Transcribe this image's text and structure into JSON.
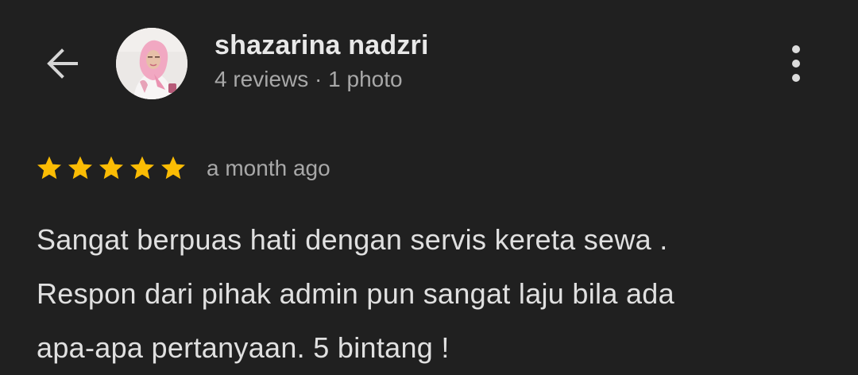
{
  "reviewer": {
    "name": "shazarina nadzri",
    "meta": "4 reviews · 1 photo"
  },
  "review": {
    "rating": 5,
    "rating_max": 5,
    "time": "a month ago",
    "lines": [
      "Sangat berpuas hati dengan servis kereta sewa .",
      "Respon dari pihak admin pun sangat laju bila ada",
      "apa-apa pertanyaan. 5 bintang !"
    ]
  },
  "icons": {
    "back": "arrow-back-icon",
    "more": "more-vert-icon",
    "star": "star-icon"
  },
  "colors": {
    "background": "#202020",
    "star": "#fbbc04",
    "primary_text": "#e8e8e8",
    "secondary_text": "#a8a8a8"
  }
}
